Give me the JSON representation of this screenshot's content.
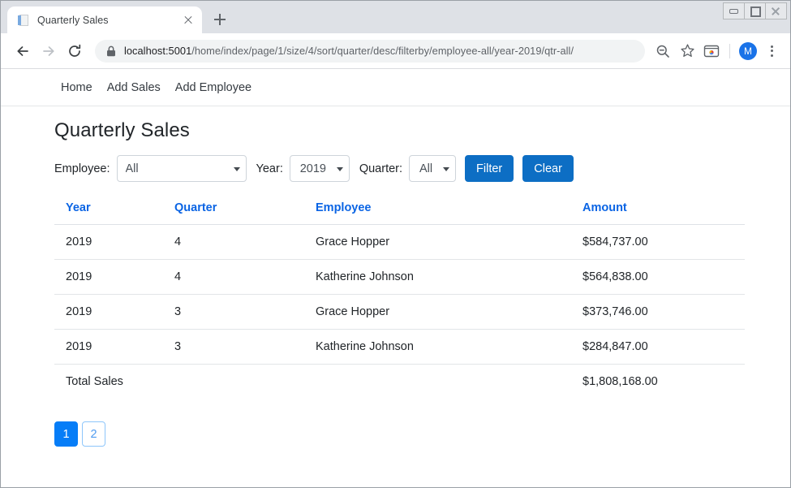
{
  "browser": {
    "tab": {
      "title": "Quarterly Sales",
      "favicon_name": "document-favicon",
      "close_label": "×"
    },
    "new_tab_label": "+",
    "window_controls": {
      "minimize": "Minimize",
      "maximize": "Restore",
      "close": "Close"
    },
    "nav": {
      "back": "Back",
      "forward": "Forward",
      "reload": "Reload"
    },
    "omnibox": {
      "lock_icon": "lock-icon",
      "host": "localhost:5001",
      "path": "/home/index/page/1/size/4/sort/quarter/desc/filterby/employee-all/year-2019/qtr-all/",
      "full_url": "localhost:5001/home/index/page/1/size/4/sort/quarter/desc/filterby/employee-all/year-2019/qtr-all/"
    },
    "actions": {
      "zoom_out": "zoom-out-icon",
      "bookmark": "star-icon",
      "extensions": "chrome-apps-icon",
      "profile_initial": "M",
      "menu": "three-dot-menu"
    }
  },
  "site_nav": {
    "items": [
      {
        "label": "Home"
      },
      {
        "label": "Add Sales"
      },
      {
        "label": "Add Employee"
      }
    ]
  },
  "page": {
    "title": "Quarterly Sales"
  },
  "filters": {
    "employee": {
      "label": "Employee:",
      "value": "All",
      "options": [
        "All"
      ]
    },
    "year": {
      "label": "Year:",
      "value": "2019",
      "options": [
        "2019"
      ]
    },
    "quarter": {
      "label": "Quarter:",
      "value": "All",
      "options": [
        "All"
      ]
    },
    "filter_button": "Filter",
    "clear_button": "Clear"
  },
  "table": {
    "headers": [
      {
        "label": "Year"
      },
      {
        "label": "Quarter"
      },
      {
        "label": "Employee"
      },
      {
        "label": "Amount"
      }
    ],
    "rows": [
      {
        "year": "2019",
        "quarter": "4",
        "employee": "Grace Hopper",
        "amount": "$584,737.00"
      },
      {
        "year": "2019",
        "quarter": "4",
        "employee": "Katherine Johnson",
        "amount": "$564,838.00"
      },
      {
        "year": "2019",
        "quarter": "3",
        "employee": "Grace Hopper",
        "amount": "$373,746.00"
      },
      {
        "year": "2019",
        "quarter": "3",
        "employee": "Katherine Johnson",
        "amount": "$284,847.00"
      }
    ],
    "total": {
      "label": "Total Sales",
      "amount": "$1,808,168.00"
    }
  },
  "pagination": {
    "pages": [
      {
        "label": "1",
        "active": true
      },
      {
        "label": "2",
        "active": false
      }
    ]
  },
  "colors": {
    "accent": "#007bff",
    "link": "#0a64e4",
    "button": "#0d6ec4",
    "avatar": "#1a73e8"
  }
}
